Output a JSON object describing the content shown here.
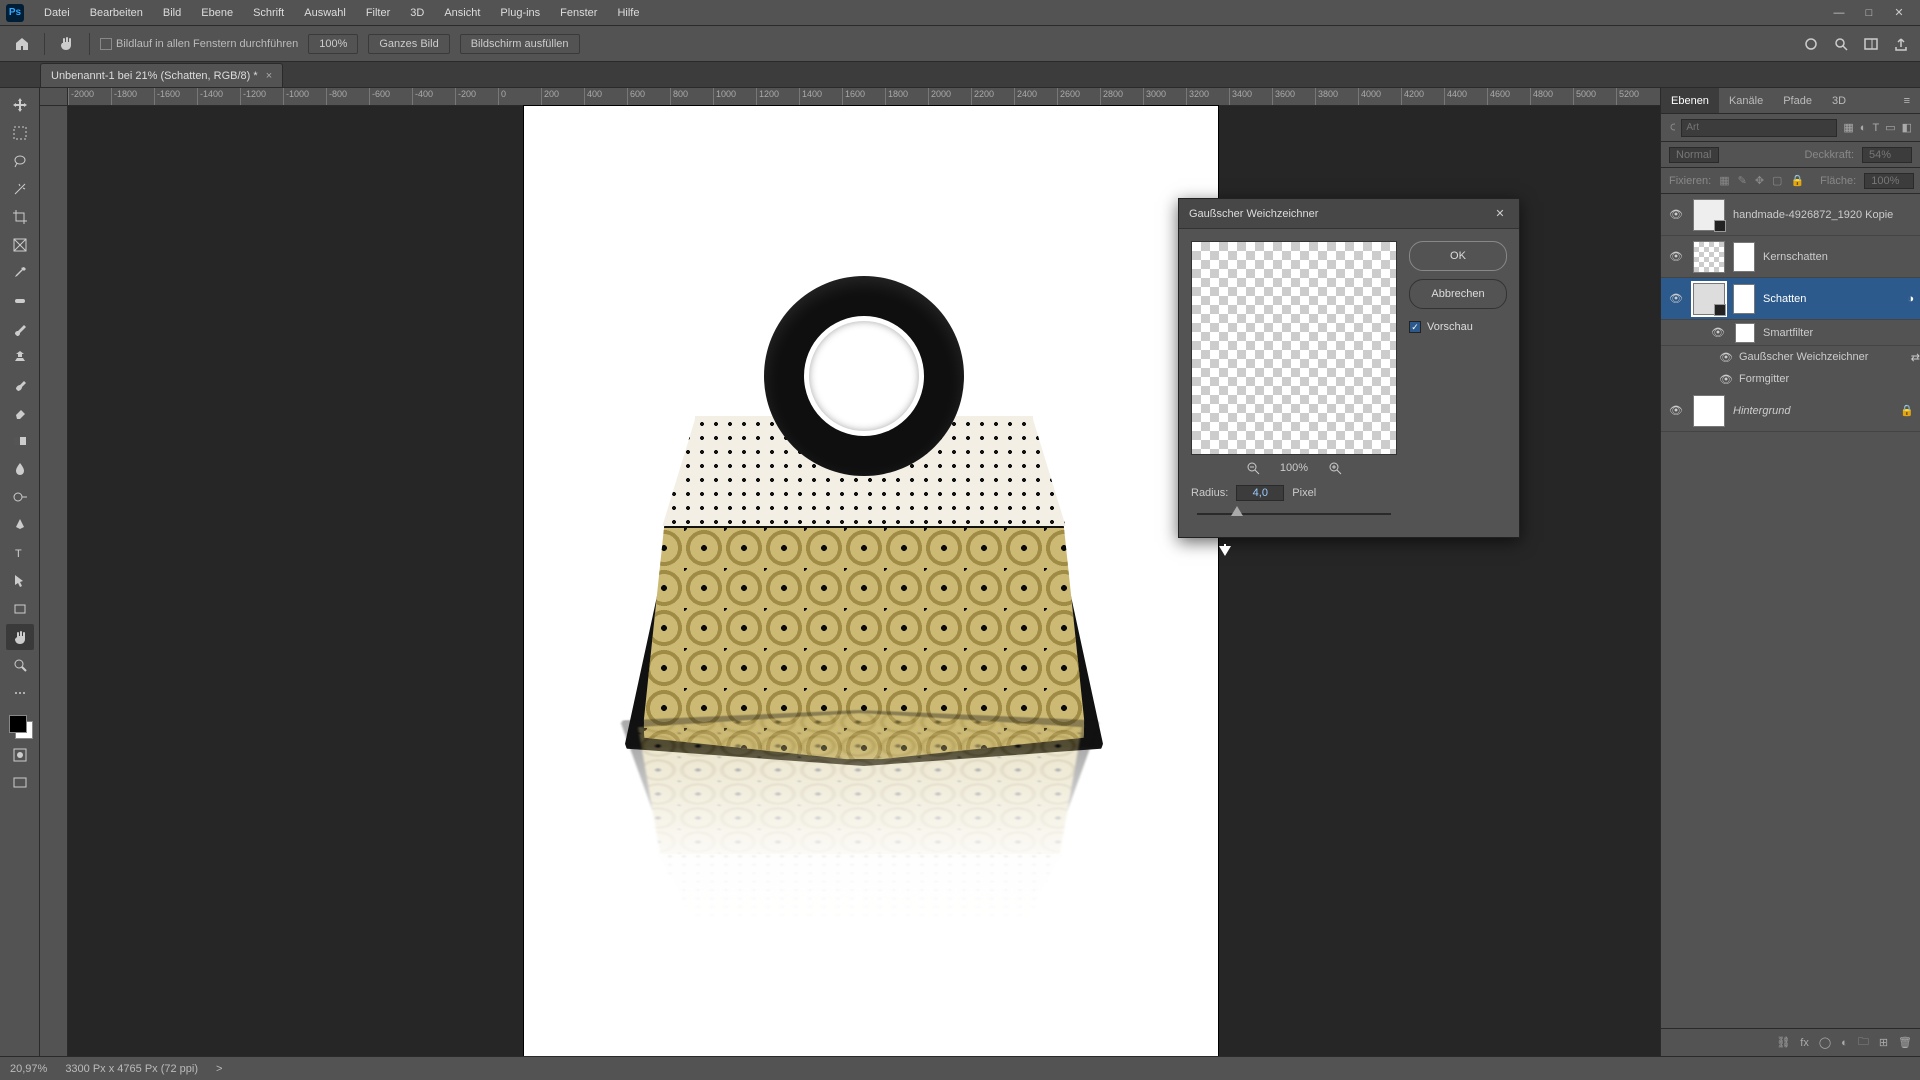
{
  "app_icon_text": "Ps",
  "menu": [
    "Datei",
    "Bearbeiten",
    "Bild",
    "Ebene",
    "Schrift",
    "Auswahl",
    "Filter",
    "3D",
    "Ansicht",
    "Plug-ins",
    "Fenster",
    "Hilfe"
  ],
  "window_controls": {
    "min": "—",
    "max": "□",
    "close": "✕"
  },
  "optbar": {
    "bildlauf_label": "Bildlauf in allen Fenstern durchführen",
    "zoom_100": "100%",
    "ganzes_bild": "Ganzes Bild",
    "bildschirm": "Bildschirm ausfüllen"
  },
  "doc_tab": {
    "title": "Unbenannt-1 bei 21% (Schatten, RGB/8) *",
    "close": "×"
  },
  "ruler_ticks": [
    "-2000",
    "-1800",
    "-1600",
    "-1400",
    "-1200",
    "-1000",
    "-800",
    "-600",
    "-400",
    "-200",
    "0",
    "200",
    "400",
    "600",
    "800",
    "1000",
    "1200",
    "1400",
    "1600",
    "1800",
    "2000",
    "2200",
    "2400",
    "2600",
    "2800",
    "3000",
    "3200",
    "3400",
    "3600",
    "3800",
    "4000",
    "4200",
    "4400",
    "4600",
    "4800",
    "5000",
    "5200"
  ],
  "right_panel": {
    "tabs": [
      "Ebenen",
      "Kanäle",
      "Pfade",
      "3D"
    ],
    "search_placeholder": "Art",
    "blend_mode": "Normal",
    "opacity_label": "Deckkraft:",
    "opacity_val": "54%",
    "lock_label": "Fixieren:",
    "fill_label": "Fläche:",
    "fill_val": "100%"
  },
  "layers": [
    {
      "name": "handmade-4926872_1920 Kopie",
      "kind": "smart",
      "eye": true
    },
    {
      "name": "Kernschatten",
      "kind": "checker-mask",
      "eye": true
    },
    {
      "name": "Schatten",
      "kind": "smart-mask",
      "eye": true,
      "selected": true,
      "smart_label": "Smartfilter",
      "filters": [
        "Gaußscher Weichzeichner",
        "Formgitter"
      ]
    },
    {
      "name": "Hintergrund",
      "kind": "locked",
      "eye": true
    }
  ],
  "dialog": {
    "title": "Gaußscher Weichzeichner",
    "ok": "OK",
    "cancel": "Abbrechen",
    "preview_label": "Vorschau",
    "zoom_val": "100%",
    "radius_label": "Radius:",
    "radius_val": "4,0",
    "radius_unit": "Pixel"
  },
  "status": {
    "zoom": "20,97%",
    "dims": "3300 Px x 4765 Px (72 ppi)",
    "arrow": ">"
  }
}
